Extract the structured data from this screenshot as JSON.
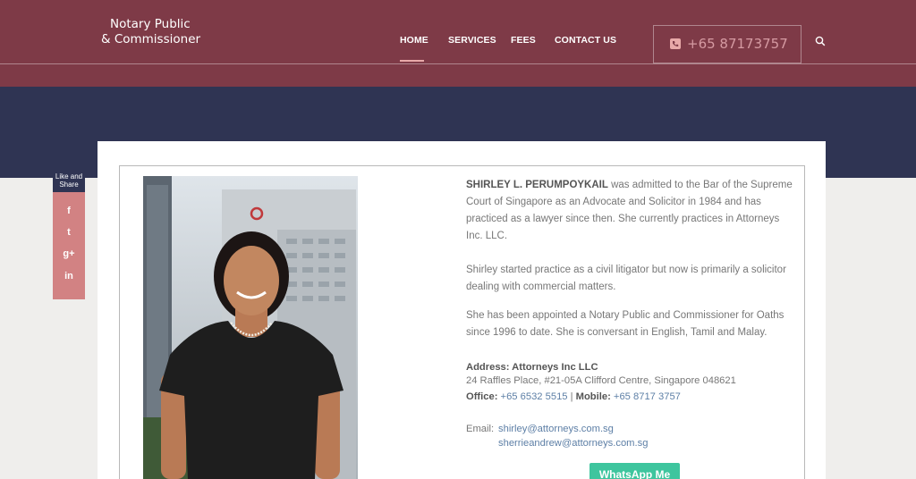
{
  "header": {
    "logo_line1": "Notary Public",
    "logo_line2": "& Commissioner",
    "nav": [
      "HOME",
      "SERVICES",
      "FEES",
      "CONTACT US"
    ],
    "active_nav": "HOME",
    "phone": "+65 87173757",
    "colors": {
      "header_bg": "#7e3a47",
      "band_bg": "#2f3453",
      "accent": "#e8a9a9"
    }
  },
  "share": {
    "label_line1": "Like and",
    "label_line2": "Share",
    "icons": [
      "facebook-icon",
      "twitter-icon",
      "google-plus-icon",
      "linkedin-icon"
    ],
    "glyphs": [
      "f",
      "t",
      "g+",
      "in"
    ]
  },
  "profile": {
    "name": "SHIRLEY L. PERUMPOYKAIL",
    "intro": " was admitted to the Bar of the Supreme Court of Singapore as an Advocate and Solicitor in 1984 and has practiced as a lawyer since then. She currently practices in Attorneys Inc. LLC.",
    "para2": "Shirley started practice as a civil litigator but now is primarily a solicitor dealing with commercial matters.",
    "para3": "She has been appointed a Notary Public and Commissioner for Oaths since 1996 to date. She  is conversant in English, Tamil and Malay."
  },
  "contact": {
    "address_heading": "Address: Attorneys Inc LLC",
    "address_line": "24 Raffles Place, #21-05A Clifford Centre, Singapore 048621",
    "office_label": "Office:",
    "office_number": "+65  6532 5515",
    "separator": "|",
    "mobile_label": "Mobile:",
    "mobile_number": "+65  8717 3757",
    "email_label": "Email:",
    "email1": "shirley@attorneys.com.sg",
    "email2": "sherrieandrew@attorneys.com.sg",
    "whatsapp_label": "WhatsApp Me"
  }
}
